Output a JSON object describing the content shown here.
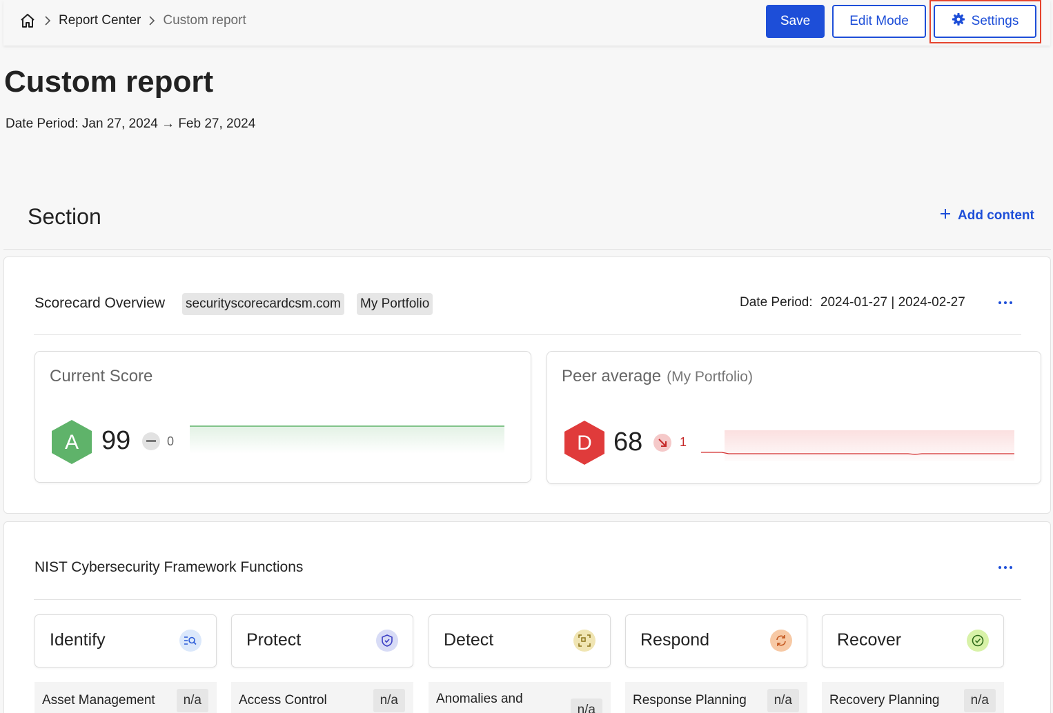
{
  "breadcrumb": {
    "items": [
      "Report Center",
      "Custom report"
    ]
  },
  "toolbar": {
    "save_label": "Save",
    "edit_label": "Edit Mode",
    "settings_label": "Settings"
  },
  "page": {
    "title": "Custom report",
    "date_period": "Date Period: Jan 27, 2024 → Feb 27, 2024"
  },
  "section": {
    "title": "Section",
    "add_content_label": "Add content"
  },
  "scorecard": {
    "title": "Scorecard Overview",
    "tags": [
      "securityscorecardcsm.com",
      "My Portfolio"
    ],
    "date_period_label": "Date Period:",
    "date_period_value": "2024-01-27 | 2024-02-27",
    "current": {
      "title": "Current Score",
      "grade": "A",
      "score": "99",
      "delta": "0",
      "grade_color": "#5fb36a"
    },
    "peer": {
      "title": "Peer average",
      "subtitle": "(My Portfolio)",
      "grade": "D",
      "score": "68",
      "delta": "1",
      "grade_color": "#e03b3b"
    }
  },
  "nist": {
    "title": "NIST Cybersecurity Framework Functions",
    "functions": [
      {
        "label": "Identify",
        "icon": "identify-search-icon",
        "sub_label": "Asset Management",
        "sub_value": "n/a"
      },
      {
        "label": "Protect",
        "icon": "shield-icon",
        "sub_label": "Access Control",
        "sub_value": "n/a"
      },
      {
        "label": "Detect",
        "icon": "scan-icon",
        "sub_label": "Anomalies and",
        "sub_value": "n/a"
      },
      {
        "label": "Respond",
        "icon": "refresh-icon",
        "sub_label": "Response Planning",
        "sub_value": "n/a"
      },
      {
        "label": "Recover",
        "icon": "check-circle-icon",
        "sub_label": "Recovery Planning",
        "sub_value": "n/a"
      }
    ]
  }
}
